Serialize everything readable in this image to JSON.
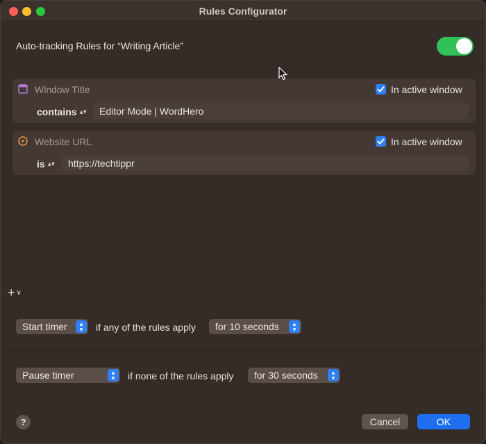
{
  "window": {
    "title": "Rules Configurator"
  },
  "header": {
    "label": "Auto-tracking Rules for “Writing Article”",
    "enabled": true
  },
  "rules": [
    {
      "name": "Window Title",
      "icon": "window-icon",
      "checkbox_label": "In active window",
      "checked": true,
      "operator": "contains",
      "value": "Editor Mode | WordHero"
    },
    {
      "name": "Website URL",
      "icon": "compass-icon",
      "checkbox_label": "In active window",
      "checked": true,
      "operator": "is",
      "value": "https://techtippr"
    }
  ],
  "add_rule": {
    "label": "+"
  },
  "start_row": {
    "action": "Start timer",
    "condition": "if any of the rules apply",
    "duration": "for 10 seconds"
  },
  "pause_row": {
    "action": "Pause timer",
    "condition": "if none of the rules apply",
    "duration": "for 30 seconds"
  },
  "footer": {
    "help": "?",
    "cancel": "Cancel",
    "ok": "OK"
  },
  "colors": {
    "accent": "#2f7ff5",
    "toggle_on": "#31c158",
    "window_bg": "#352b27"
  }
}
